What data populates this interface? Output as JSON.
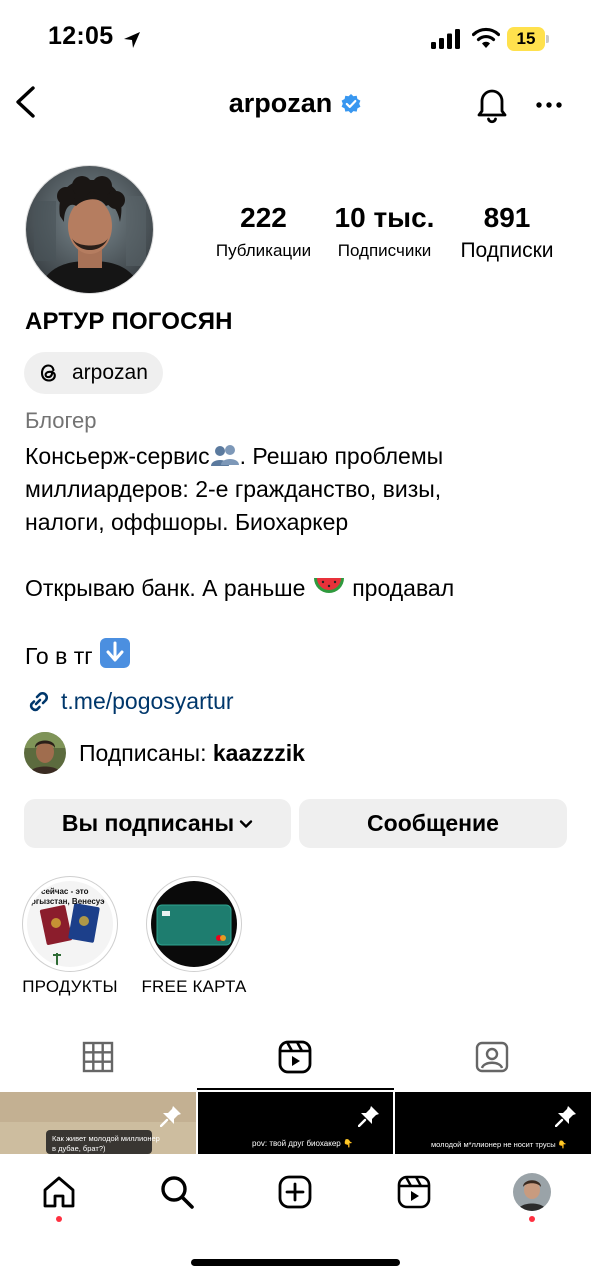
{
  "status_bar": {
    "time": "12:05",
    "battery": "15"
  },
  "header": {
    "username": "arpozan"
  },
  "stats": [
    {
      "value": "222",
      "label": "Публикации"
    },
    {
      "value": "10 тыс.",
      "label": "Подписчики"
    },
    {
      "value": "891",
      "label": "Подписки"
    }
  ],
  "profile": {
    "full_name": "АРТУР ПОГОСЯН",
    "threads_handle": "arpozan",
    "category": "Блогер",
    "bio_line1_a": "Консьерж-сервис",
    "bio_line1_b": ". Решаю проблемы",
    "bio_line2": "миллиардеров: 2-е гражданство, визы,",
    "bio_line3": "налоги, оффшоры. Биохаркер",
    "bio_line4_a": "Открываю банк. А раньше ",
    "bio_line4_b": " продавал",
    "bio_line5": "Го в тг ",
    "link": "t.me/pogosyartur",
    "followed_by_label": "Подписаны: ",
    "followed_by_user": "kaazzzik"
  },
  "buttons": {
    "following": "Вы подписаны",
    "message": "Сообщение"
  },
  "highlights": [
    {
      "label": "ПРОДУКТЫ",
      "cover_text_1": "сейчас - это",
      "cover_text_2": "ргызстан, Венесуэ"
    },
    {
      "label": "FREE КАРТА"
    }
  ],
  "grid": [
    {
      "caption_1": "Как живет молодой миллионер",
      "caption_2": "в дубае, брат?)"
    },
    {
      "caption_1": "pov: твой друг биохакер 👇"
    },
    {
      "caption_1": "молодой м*ллионер не носит трусы 👇"
    }
  ],
  "colors": {
    "verified": "#3897f0",
    "link": "#00376b",
    "button_bg": "#efefef",
    "notification_dot": "#ff3040"
  }
}
